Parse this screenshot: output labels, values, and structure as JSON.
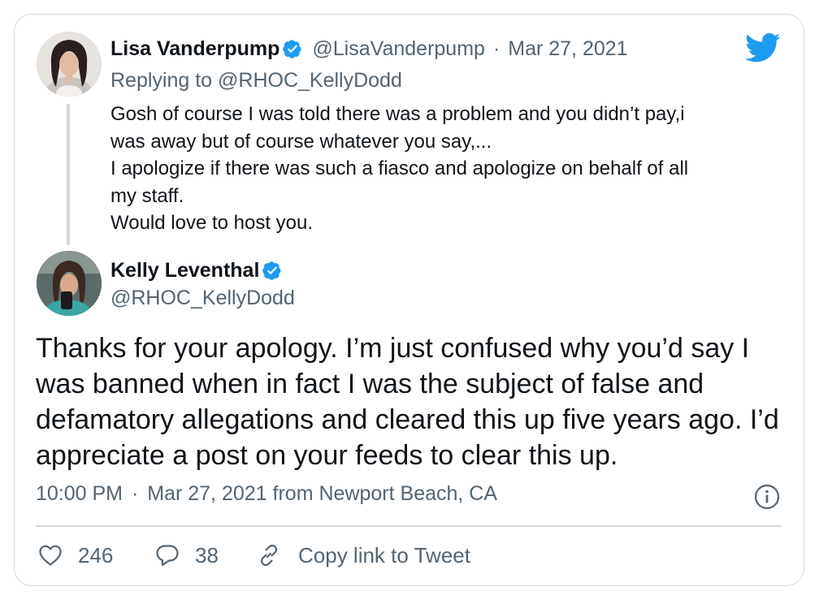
{
  "parent_tweet": {
    "author_name": "Lisa Vanderpump",
    "handle": "@LisaVanderpump",
    "separator": "·",
    "date": "Mar 27, 2021",
    "replying_prefix": "Replying to",
    "replying_handle": "@RHOC_KellyDodd",
    "body_lines": [
      "Gosh of course I was told there was a problem and you didn’t pay,i",
      "was away but of course whatever you say,...",
      "I apologize if there was such a fiasco and apologize on behalf of all",
      "my staff.",
      "Would love to host you."
    ]
  },
  "main_tweet": {
    "author_name": "Kelly Leventhal",
    "handle": "@RHOC_KellyDodd",
    "body_lines": [
      "Thanks for your apology. I’m just confused why you’d say I",
      "was banned when in fact I was the subject of false and",
      "defamatory allegations and cleared this up five years ago. I’d",
      "appreciate a post on your feeds to clear this up."
    ],
    "time": "10:00 PM",
    "separator": "·",
    "date": "Mar 27, 2021",
    "source_prefix": "from",
    "location": "Newport Beach, CA"
  },
  "actions": {
    "like_count": "246",
    "reply_count": "38",
    "copy_link_label": "Copy link to Tweet"
  },
  "icons": {
    "logo": "twitter-bird-icon",
    "verified": "verified-badge-icon",
    "info": "info-icon",
    "like": "heart-icon",
    "reply": "speech-bubble-icon",
    "copy": "link-icon"
  },
  "colors": {
    "brand": "#1d9bf0",
    "text": "#0f1419",
    "muted": "#536471",
    "border": "#cfd9de"
  }
}
